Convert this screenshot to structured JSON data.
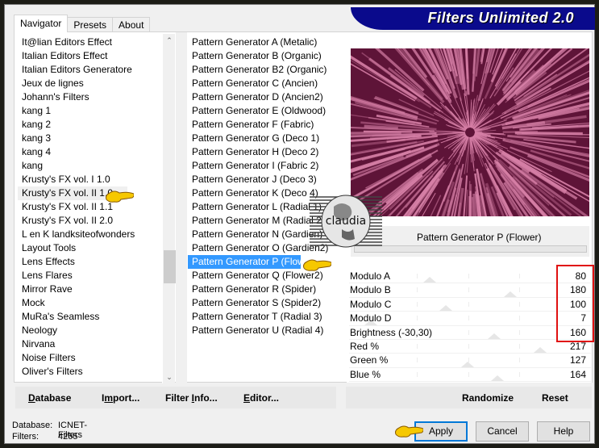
{
  "app": {
    "title": "Filters Unlimited 2.0"
  },
  "tabs": [
    {
      "label": "Navigator",
      "active": true
    },
    {
      "label": "Presets",
      "active": false
    },
    {
      "label": "About",
      "active": false
    }
  ],
  "categories": {
    "items": [
      "It@lian Editors Effect",
      "Italian Editors Effect",
      "Italian Editors Generatore",
      "Jeux de lignes",
      "Johann's Filters",
      "kang 1",
      "kang 2",
      "kang 3",
      "kang 4",
      "kang",
      "Krusty's FX vol. I 1.0",
      "Krusty's FX vol. II 1.0",
      "Krusty's FX vol. II 1.1",
      "Krusty's FX vol. II 2.0",
      "L en K landksiteofwonders",
      "Layout Tools",
      "Lens Effects",
      "Lens Flares",
      "Mirror Rave",
      "Mock",
      "MuRa's Seamless",
      "Neology",
      "Nirvana",
      "Noise Filters",
      "Oliver's Filters"
    ],
    "selected_index": 11,
    "scroll_position_fraction": 0.62
  },
  "filters": {
    "items": [
      "Pattern Generator A (Metalic)",
      "Pattern Generator B (Organic)",
      "Pattern Generator B2 (Organic)",
      "Pattern Generator C (Ancien)",
      "Pattern Generator D (Ancien2)",
      "Pattern Generator E (Oldwood)",
      "Pattern Generator F (Fabric)",
      "Pattern Generator G (Deco 1)",
      "Pattern Generator H (Deco 2)",
      "Pattern Generator I (Fabric 2)",
      "Pattern Generator J (Deco 3)",
      "Pattern Generator K (Deco 4)",
      "Pattern Generator L (Radial 1)",
      "Pattern Generator M (Radial 2)",
      "Pattern Generator N (Gardien)",
      "Pattern Generator O (Gardien2)",
      "Pattern Generator P (Flower)",
      "Pattern Generator Q (Flower2)",
      "Pattern Generator R (Spider)",
      "Pattern Generator S (Spider2)",
      "Pattern Generator T (Radial 3)",
      "Pattern Generator U (Radial 4)"
    ],
    "selected_index": 16
  },
  "preview": {
    "filter_name": "Pattern Generator P (Flower)",
    "colors": {
      "dark": "#5e1438",
      "light": "#d67fa6"
    },
    "logo_text": "claudia"
  },
  "params": [
    {
      "label": "Modulo A",
      "value": 80,
      "max": 255
    },
    {
      "label": "Modulo B",
      "value": 180,
      "max": 255
    },
    {
      "label": "Modulo C",
      "value": 100,
      "max": 255
    },
    {
      "label": "Modulo D",
      "value": 7,
      "max": 255
    },
    {
      "label": "Brightness (-30,30)",
      "value": 160,
      "max": 255
    },
    {
      "label": "Red %",
      "value": 217,
      "max": 255
    },
    {
      "label": "Green %",
      "value": 127,
      "max": 255
    },
    {
      "label": "Blue %",
      "value": 164,
      "max": 255
    }
  ],
  "toolbar": {
    "database": {
      "label": "Database",
      "accel": "D"
    },
    "import": {
      "label": "Import...",
      "accel": "m"
    },
    "filter_info": {
      "label": "Filter Info...",
      "accel": "I"
    },
    "editor": {
      "label": "Editor...",
      "accel": "E"
    },
    "randomize": "Randomize",
    "reset": "Reset"
  },
  "status": {
    "database_label": "Database:",
    "database_value": "ICNET-Filters",
    "filters_label": "Filters:",
    "filters_value": "4255"
  },
  "buttons": {
    "apply": "Apply",
    "cancel": "Cancel",
    "help": "Help"
  },
  "accent": {
    "selection": "#3399ff",
    "banner": "#0a0a8c",
    "highlight_box": "#e01010",
    "default_button": "#0078d7"
  }
}
